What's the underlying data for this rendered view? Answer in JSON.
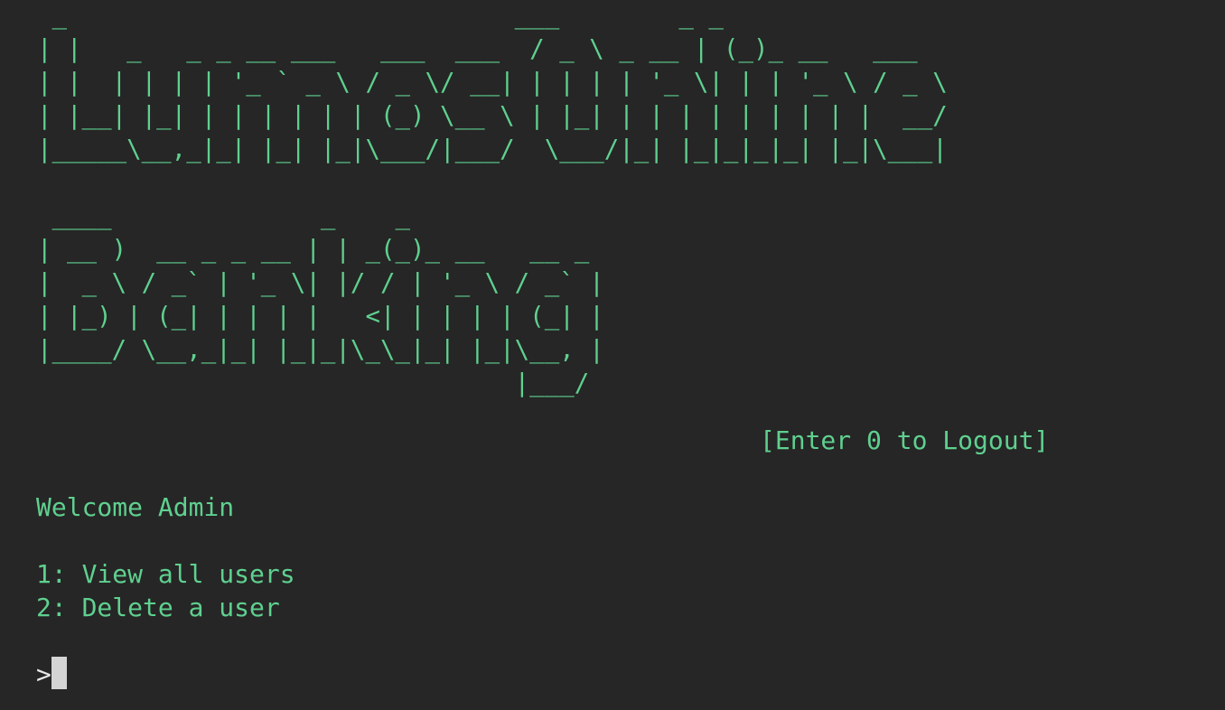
{
  "banner": {
    "title_art_line1": " _                              ___        _ _\n| |   _   _ _ __ ___   ___  ___  / _ \\ _ __ | (_)_ __   ___\n| |  | | | | '_ ` _ \\ / _ \\/ __| | | | | '_ \\| | | '_ \\ / _ \\\n| |__| |_| | | | | | | (_) \\__ \\ | |_| | | | | | | | | |  __/\n|_____\\__,_|_| |_| |_|\\___/|___/  \\___/|_| |_|_|_|_| |_|\\___|",
    "title_art_line2": " ____              _    _\n| __ )  __ _ _ __ | | _(_)_ __   __ _\n|  _ \\ / _` | '_ \\| |/ / | '_ \\ / _` |\n| |_) | (_| | | | |   <| | | | | (_| |\n|____/ \\__,_|_| |_|_|\\_\\_|_| |_|\\__, |\n                                |___/"
  },
  "logout_hint": "[Enter 0 to Logout]",
  "welcome": "Welcome Admin",
  "menu": [
    {
      "label": "1: View all users"
    },
    {
      "label": "2: Delete a user"
    }
  ],
  "prompt": {
    "symbol": ">"
  },
  "colors": {
    "background": "#262626",
    "text": "#5fd08f",
    "cursor": "#d4d4d4"
  }
}
